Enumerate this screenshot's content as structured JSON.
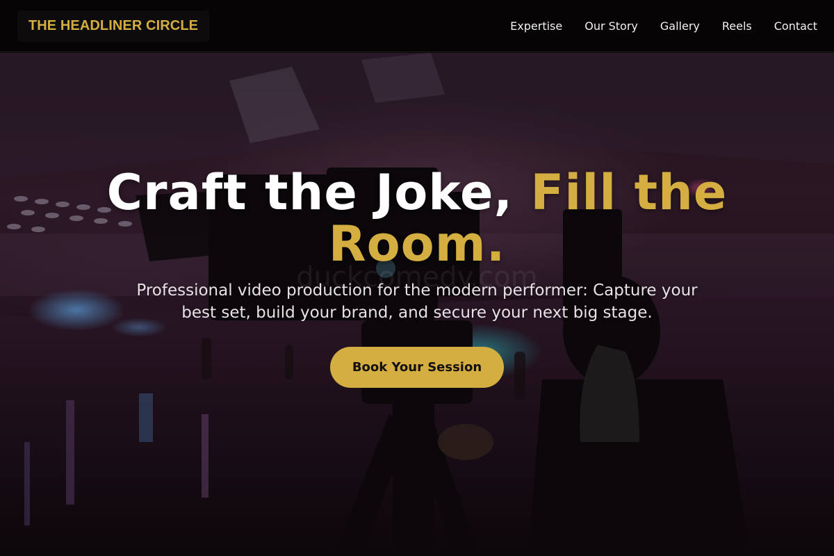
{
  "brand": {
    "logo_text": "THE HEADLINER CIRCLE",
    "accent_color": "#d4ae40"
  },
  "nav": {
    "items": [
      {
        "label": "Expertise"
      },
      {
        "label": "Our Story"
      },
      {
        "label": "Gallery"
      },
      {
        "label": "Reels"
      },
      {
        "label": "Contact"
      }
    ]
  },
  "hero": {
    "headline_part1": "Craft the Joke,",
    "headline_accent": "Fill the Room.",
    "subtitle": "Professional video production for the modern performer: Capture your best set, build your brand, and secure your next big stage.",
    "watermark": "duckcomedy.com",
    "cta_label": "Book Your Session"
  }
}
